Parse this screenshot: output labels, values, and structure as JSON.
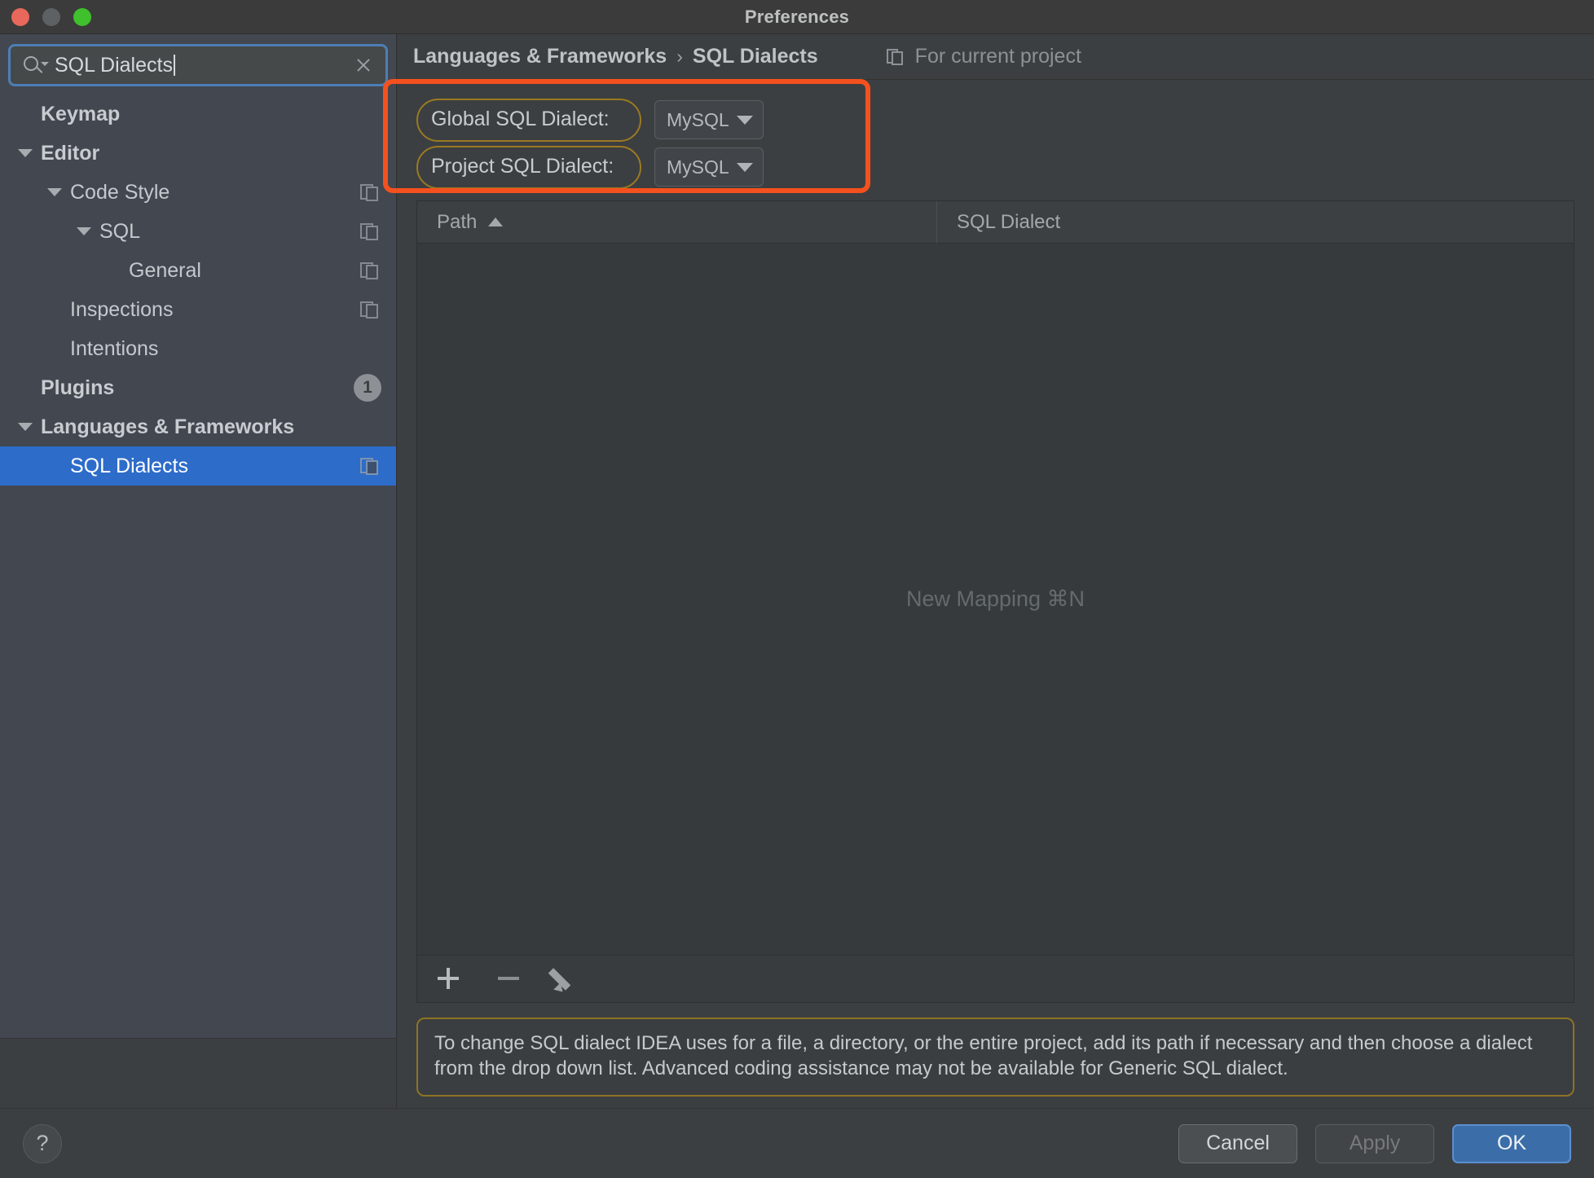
{
  "window": {
    "title": "Preferences",
    "traffic_lights": [
      "close-button",
      "minimize-button",
      "zoom-button"
    ]
  },
  "search": {
    "value": "SQL Dialects",
    "placeholder": "Search",
    "icon": "search-icon",
    "clear_icon": "close-icon"
  },
  "sidebar": {
    "items": [
      {
        "label": "Keymap",
        "depth": 0,
        "bold": true,
        "twisty": "none",
        "right": "none"
      },
      {
        "label": "Editor",
        "depth": 0,
        "bold": true,
        "twisty": "expanded",
        "right": "none"
      },
      {
        "label": "Code Style",
        "depth": 1,
        "bold": false,
        "twisty": "expanded",
        "right": "copy-icon"
      },
      {
        "label": "SQL",
        "depth": 2,
        "bold": false,
        "twisty": "expanded",
        "right": "copy-icon"
      },
      {
        "label": "General",
        "depth": 3,
        "bold": false,
        "twisty": "none",
        "right": "copy-icon"
      },
      {
        "label": "Inspections",
        "depth": 1,
        "bold": false,
        "twisty": "none",
        "right": "copy-icon"
      },
      {
        "label": "Intentions",
        "depth": 1,
        "bold": false,
        "twisty": "none",
        "right": "none"
      },
      {
        "label": "Plugins",
        "depth": 0,
        "bold": true,
        "twisty": "none",
        "right": "badge",
        "badge": "1"
      },
      {
        "label": "Languages & Frameworks",
        "depth": 0,
        "bold": true,
        "twisty": "expanded",
        "right": "none"
      },
      {
        "label": "SQL Dialects",
        "depth": 1,
        "bold": false,
        "twisty": "none",
        "right": "copy-icon",
        "selected": true
      }
    ]
  },
  "header": {
    "breadcrumb_parent": "Languages & Frameworks",
    "breadcrumb_separator": "›",
    "breadcrumb_current": "SQL Dialects",
    "scope_label": "For current project",
    "scope_icon": "project-scope-icon"
  },
  "dialects": {
    "global": {
      "label": "Global SQL Dialect:",
      "value": "MySQL"
    },
    "project": {
      "label": "Project SQL Dialect:",
      "value": "MySQL"
    },
    "highlight_color": "#f4511e",
    "label_outline_color": "#9a7a22"
  },
  "mappings_table": {
    "columns": [
      "Path",
      "SQL Dialect"
    ],
    "sort_column": "Path",
    "sort_direction": "ascending",
    "rows": [],
    "empty_text": "New Mapping ⌘N",
    "toolbar": [
      {
        "name": "add-mapping-button",
        "icon": "plus-icon"
      },
      {
        "name": "remove-mapping-button",
        "icon": "minus-icon"
      },
      {
        "name": "edit-mapping-button",
        "icon": "pencil-icon"
      }
    ]
  },
  "info": {
    "text": "To change SQL dialect IDEA uses for a file, a directory, or the entire project, add its path if necessary and then choose a dialect from the drop down list. Advanced coding assistance may not be available for Generic SQL dialect.",
    "border_color": "#8d7325"
  },
  "footer": {
    "help_label": "?",
    "cancel_label": "Cancel",
    "apply_label": "Apply",
    "ok_label": "OK",
    "ok_accent": "#3b6ea8"
  }
}
